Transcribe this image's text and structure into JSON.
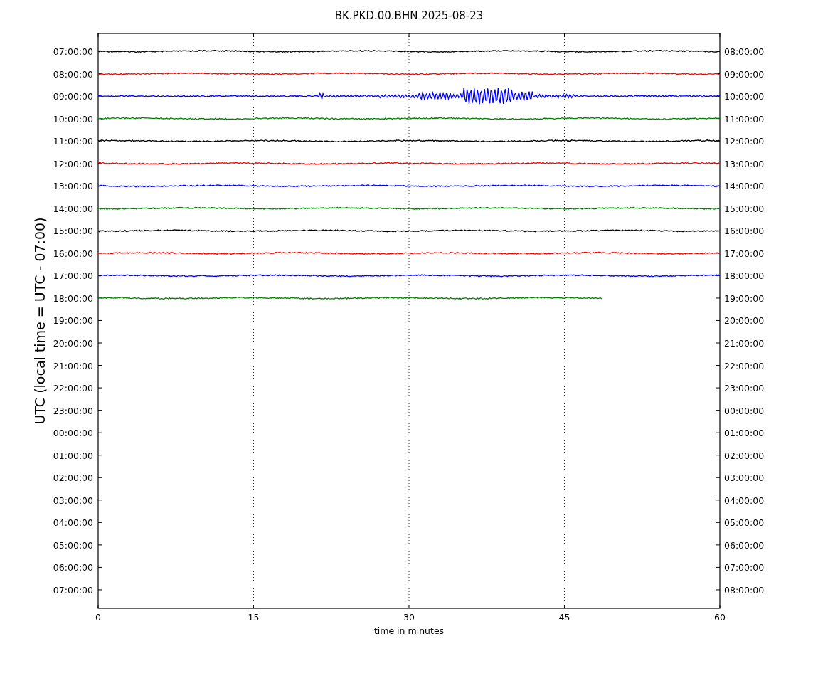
{
  "title": "BK.PKD.00.BHN 2025-08-23",
  "ylabel": "UTC (local time = UTC - 07:00)",
  "xlabel": "time in minutes",
  "xticks": [
    "0",
    "15",
    "30",
    "45",
    "60"
  ],
  "rows": [
    {
      "left": "07:00:00",
      "right": "08:00:00"
    },
    {
      "left": "08:00:00",
      "right": "09:00:00"
    },
    {
      "left": "09:00:00",
      "right": "10:00:00"
    },
    {
      "left": "10:00:00",
      "right": "11:00:00"
    },
    {
      "left": "11:00:00",
      "right": "12:00:00"
    },
    {
      "left": "12:00:00",
      "right": "13:00:00"
    },
    {
      "left": "13:00:00",
      "right": "14:00:00"
    },
    {
      "left": "14:00:00",
      "right": "15:00:00"
    },
    {
      "left": "15:00:00",
      "right": "16:00:00"
    },
    {
      "left": "16:00:00",
      "right": "17:00:00"
    },
    {
      "left": "17:00:00",
      "right": "18:00:00"
    },
    {
      "left": "18:00:00",
      "right": "19:00:00"
    },
    {
      "left": "19:00:00",
      "right": "20:00:00"
    },
    {
      "left": "20:00:00",
      "right": "21:00:00"
    },
    {
      "left": "21:00:00",
      "right": "22:00:00"
    },
    {
      "left": "22:00:00",
      "right": "23:00:00"
    },
    {
      "left": "23:00:00",
      "right": "00:00:00"
    },
    {
      "left": "00:00:00",
      "right": "01:00:00"
    },
    {
      "left": "01:00:00",
      "right": "02:00:00"
    },
    {
      "left": "02:00:00",
      "right": "03:00:00"
    },
    {
      "left": "03:00:00",
      "right": "04:00:00"
    },
    {
      "left": "04:00:00",
      "right": "05:00:00"
    },
    {
      "left": "05:00:00",
      "right": "06:00:00"
    },
    {
      "left": "06:00:00",
      "right": "07:00:00"
    },
    {
      "left": "07:00:00",
      "right": "08:00:00"
    }
  ],
  "traces": [
    {
      "kind": "quiet",
      "color": "#000000",
      "level": 1
    },
    {
      "kind": "quiet",
      "color": "#ff0000",
      "level": 1
    },
    {
      "kind": "event",
      "color": "#0000ff",
      "level": 1
    },
    {
      "kind": "quiet",
      "color": "#008000",
      "level": 1
    },
    {
      "kind": "quiet",
      "color": "#000000",
      "level": 1
    },
    {
      "kind": "quiet",
      "color": "#ff0000",
      "level": 1
    },
    {
      "kind": "quiet",
      "color": "#0000ff",
      "level": 1
    },
    {
      "kind": "quiet",
      "color": "#008000",
      "level": 1
    },
    {
      "kind": "quiet",
      "color": "#000000",
      "level": 1
    },
    {
      "kind": "quiet",
      "color": "#ff0000",
      "level": 1
    },
    {
      "kind": "quiet",
      "color": "#0000ff",
      "level": 1
    },
    {
      "kind": "quiet",
      "color": "#008000",
      "level": 0.81
    }
  ]
}
